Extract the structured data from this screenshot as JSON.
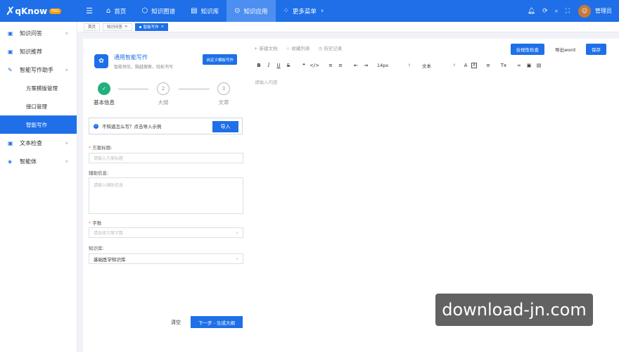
{
  "app": {
    "logo_mark": "✗",
    "logo_text": "qKnow",
    "logo_badge": "PRO"
  },
  "topnav": {
    "items": [
      {
        "label": "首页",
        "icon": "home-icon"
      },
      {
        "label": "知识图谱",
        "icon": "graph-icon"
      },
      {
        "label": "知识库",
        "icon": "book-icon"
      },
      {
        "label": "知识应用",
        "icon": "apps-icon"
      },
      {
        "label": "更多菜单",
        "icon": "grid-icon"
      }
    ],
    "active": "知识应用",
    "user": "管理员"
  },
  "sidebar": {
    "items": [
      {
        "label": "知识问答"
      },
      {
        "label": "知识推荐"
      },
      {
        "label": "智能写作助手"
      },
      {
        "label": "文本检查"
      },
      {
        "label": "智能体"
      }
    ],
    "sub_items": [
      {
        "label": "方案模版管理"
      },
      {
        "label": "接口管理"
      },
      {
        "label": "智能写作"
      }
    ]
  },
  "tabs": [
    {
      "label": "首页"
    },
    {
      "label": "知识问答"
    },
    {
      "label": "智能写作"
    }
  ],
  "writer": {
    "title": "通用智能写作",
    "subtitle": "智能预见，脑越搜索，轻松书写",
    "custom_button": "自定义模板写作",
    "steps": [
      {
        "num": "✓",
        "label": "基本信息"
      },
      {
        "num": "2",
        "label": "大纲"
      },
      {
        "num": "3",
        "label": "文章"
      }
    ],
    "tip": "不知道怎么写？点击导入示例",
    "import_button": "导入",
    "fields": {
      "title_label": "方案标题:",
      "title_placeholder": "请输入方案标题",
      "aux_label": "辅助信息:",
      "aux_placeholder": "请输入辅助信息",
      "words_label": "字数",
      "words_placeholder": "请选择方案字数",
      "kb_label": "知识库:",
      "kb_value": "基础医学知识库"
    },
    "clear_button": "清空",
    "next_button": "下一步 - 生成大纲"
  },
  "editor": {
    "links": [
      {
        "icon": "+",
        "label": "新建文档"
      },
      {
        "icon": "☆",
        "label": "收藏列表"
      },
      {
        "icon": "◷",
        "label": "历史记录"
      }
    ],
    "check_button": "合规性检查",
    "export_button": "导出word",
    "save_button": "保存",
    "toolbar": {
      "bold": "B",
      "italic": "I",
      "underline": "U",
      "strike": "S",
      "quote": "❝",
      "code": "</>",
      "ol": "≡",
      "ul": "≡",
      "outdent": "⇤",
      "indent": "⇥",
      "font_size": "14px",
      "block": "文本",
      "color": "A",
      "bg": "A",
      "align": "≡",
      "clear": "Tx",
      "link": "∞",
      "image": "▣",
      "video": "▤"
    },
    "placeholder": "请输入内容"
  },
  "watermark": "download-jn.com"
}
